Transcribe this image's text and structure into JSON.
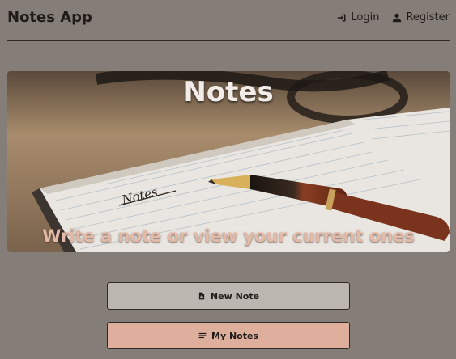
{
  "navbar": {
    "brand": "Notes App",
    "login_label": "Login",
    "register_label": "Register"
  },
  "hero": {
    "title": "Notes",
    "subtitle": "Write a note or view your current ones",
    "notebook_text": "Notes"
  },
  "actions": {
    "new_note_label": "New Note",
    "my_notes_label": "My Notes"
  },
  "icons": {
    "login": "sign-in-icon",
    "register": "user-icon",
    "new_note": "file-plus-icon",
    "my_notes": "list-icon"
  },
  "colors": {
    "page_background": "#857d78",
    "new_note_button": "#bcb6b1",
    "my_notes_button": "#dfaf9d",
    "hero_subtitle": "#e3b9a8"
  }
}
